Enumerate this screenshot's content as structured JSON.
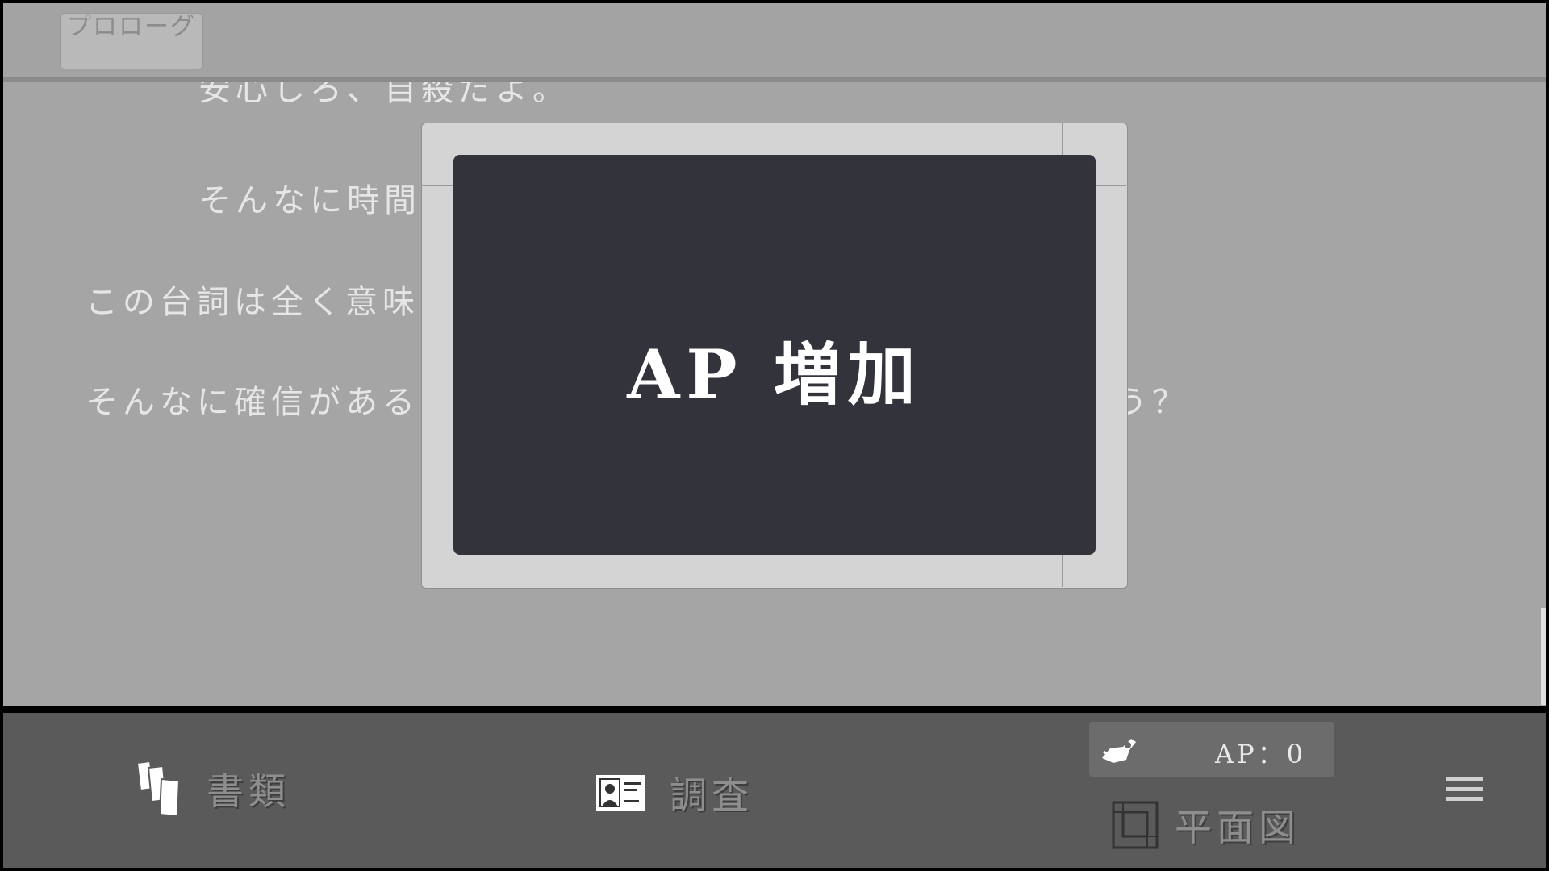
{
  "header": {
    "chapter_label": "プロローグ"
  },
  "story": {
    "lines": [
      "安心しろ、自殺だよ。",
      "そんなに時間",
      "この台詞は全く意味",
      "そんなに確信がある",
      "う？"
    ]
  },
  "modal": {
    "title": "AP 増加"
  },
  "bottom_bar": {
    "documents_label": "書類",
    "investigate_label": "調査",
    "ap_label": "AP：0",
    "floorplan_label": "平面図"
  },
  "colors": {
    "modal_bg": "#33333c",
    "frame": "#d4d4d4",
    "story_bg": "#a5a5a5",
    "bar_bg": "#5a5a5a"
  },
  "icons": [
    "documents-icon",
    "investigate-icon",
    "ap-icon",
    "floorplan-icon",
    "menu-icon"
  ]
}
